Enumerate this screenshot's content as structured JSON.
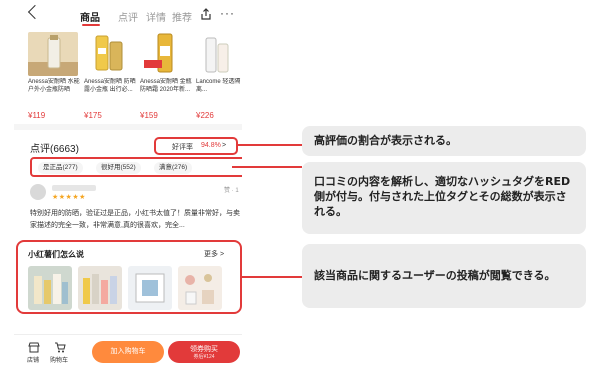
{
  "header": {
    "tabs": [
      {
        "label": "商品",
        "active": true
      },
      {
        "label": "点评",
        "active": false
      },
      {
        "label": "详情",
        "active": false
      },
      {
        "label": "推荐",
        "active": false
      }
    ],
    "more_label": "···"
  },
  "products": [
    {
      "name": "Anessa安耐晒 水能户外小金瓶防晒",
      "price": "¥119",
      "image": "anessa-bottle"
    },
    {
      "name": "Anessa安耐晒 防晒露小金瓶 出行必...",
      "price": "¥175",
      "image": "anessa-gold-bottle"
    },
    {
      "name": "Anessa安耐晒 金瓶防晒霜 2020年新...",
      "price": "¥159",
      "image": "anessa-new-bottle"
    },
    {
      "name": "Lancome 轻透隔离...",
      "price": "¥226",
      "image": "lancome-tube"
    }
  ],
  "reviews": {
    "title": "点评(6663)",
    "ratio_label": "好评率",
    "ratio_value": "94.8%",
    "ratio_arrow": ">",
    "tags": [
      "是正品(277)",
      "很好用(552)",
      "满意(276)"
    ],
    "reviewer": {
      "stars": "★★★★★",
      "likes": "赞 · 1",
      "text": "特别好用的防晒，验证过是正品，小红书太值了！质量非常好，与卖家描述的完全一致，非常满意,真的很喜欢，完全..."
    }
  },
  "xhs": {
    "title": "小红薯们怎么说",
    "more": "更多 >",
    "photos": [
      "sunscreen-bottles",
      "sunscreen-lineup",
      "sunscreen-box",
      "makeup-flatlay"
    ]
  },
  "bottom_bar": {
    "store_label": "店铺",
    "cart_label": "购物车",
    "add_to_cart": "加入购物车",
    "buy_now": "领券购买",
    "buy_sub": "券后¥124"
  },
  "callouts": [
    {
      "text": "高評価の割合が表示される。"
    },
    {
      "text": "口コミの内容を解析し、適切なハッシュタグをRED側が付与。付与された上位タグとその総数が表示される。"
    },
    {
      "text": "該当商品に関するユーザーの投稿が閲覧できる。"
    }
  ],
  "colors": {
    "accent": "#e23a3a",
    "cart": "#ff8a3d",
    "callout_bg": "#ececec"
  }
}
